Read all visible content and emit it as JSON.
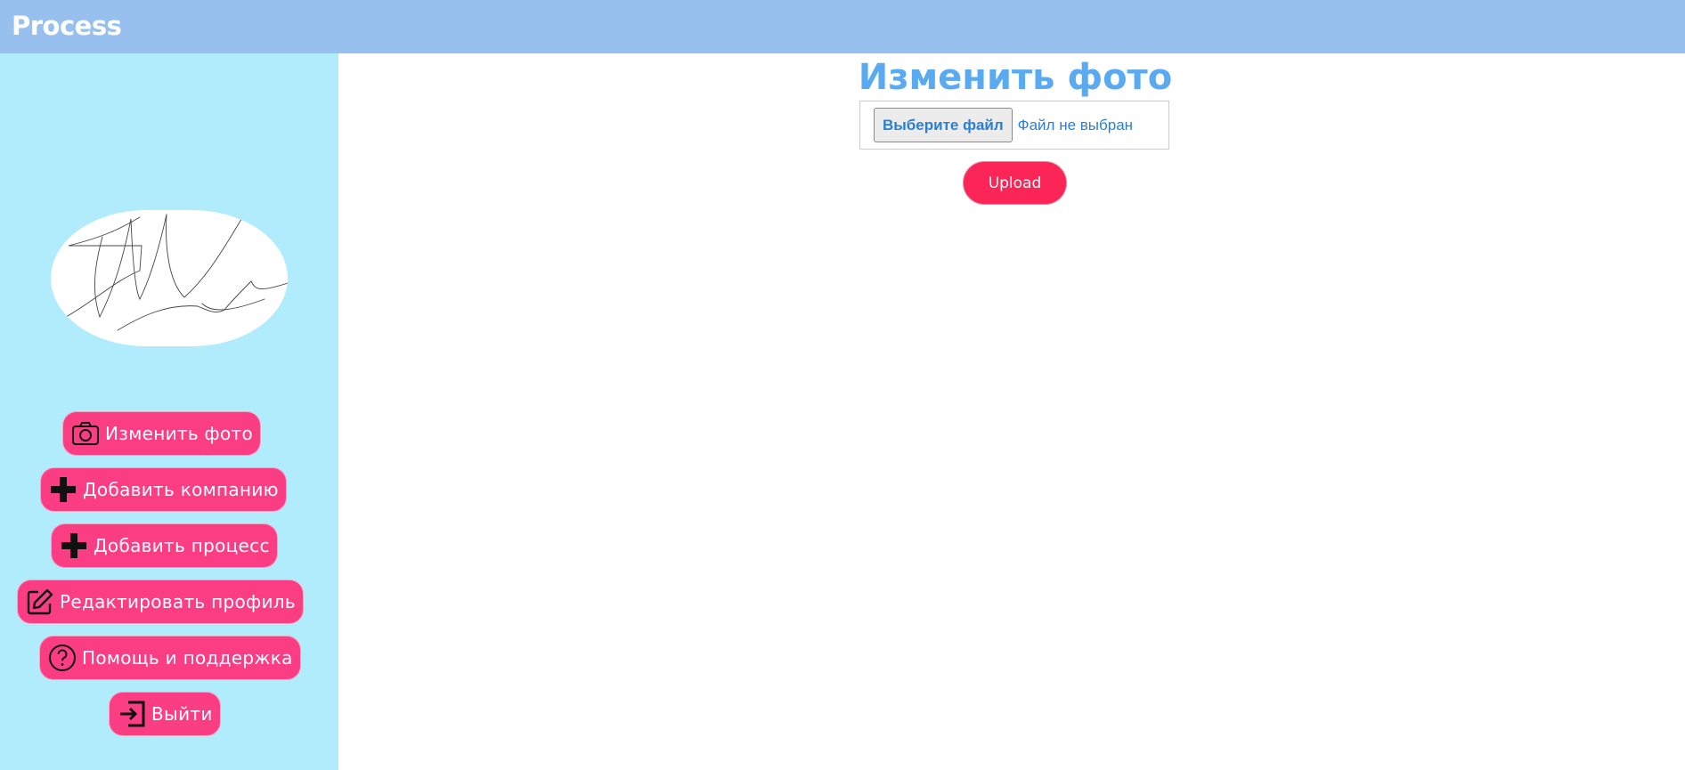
{
  "app": {
    "brand": "Process"
  },
  "sidebar": {
    "items": [
      {
        "label": "Изменить фото",
        "icon": "camera-icon"
      },
      {
        "label": "Добавить компанию",
        "icon": "plus-icon"
      },
      {
        "label": "Добавить процесс",
        "icon": "plus-icon"
      },
      {
        "label": "Редактировать профиль",
        "icon": "edit-icon"
      },
      {
        "label": "Помощь и поддержка",
        "icon": "question-circle-icon"
      },
      {
        "label": "Выйти",
        "icon": "logout-icon"
      }
    ]
  },
  "main": {
    "title": "Изменить фото",
    "file_input": {
      "button_label": "Выберите файл",
      "status": "Файл не выбран"
    },
    "upload_label": "Upload"
  },
  "colors": {
    "topbar": "#97c0ee",
    "sidebar": "#b0ecfb",
    "menu_button": "#fb3d84",
    "upload_button": "#fb2557",
    "title": "#5aaaf1"
  }
}
